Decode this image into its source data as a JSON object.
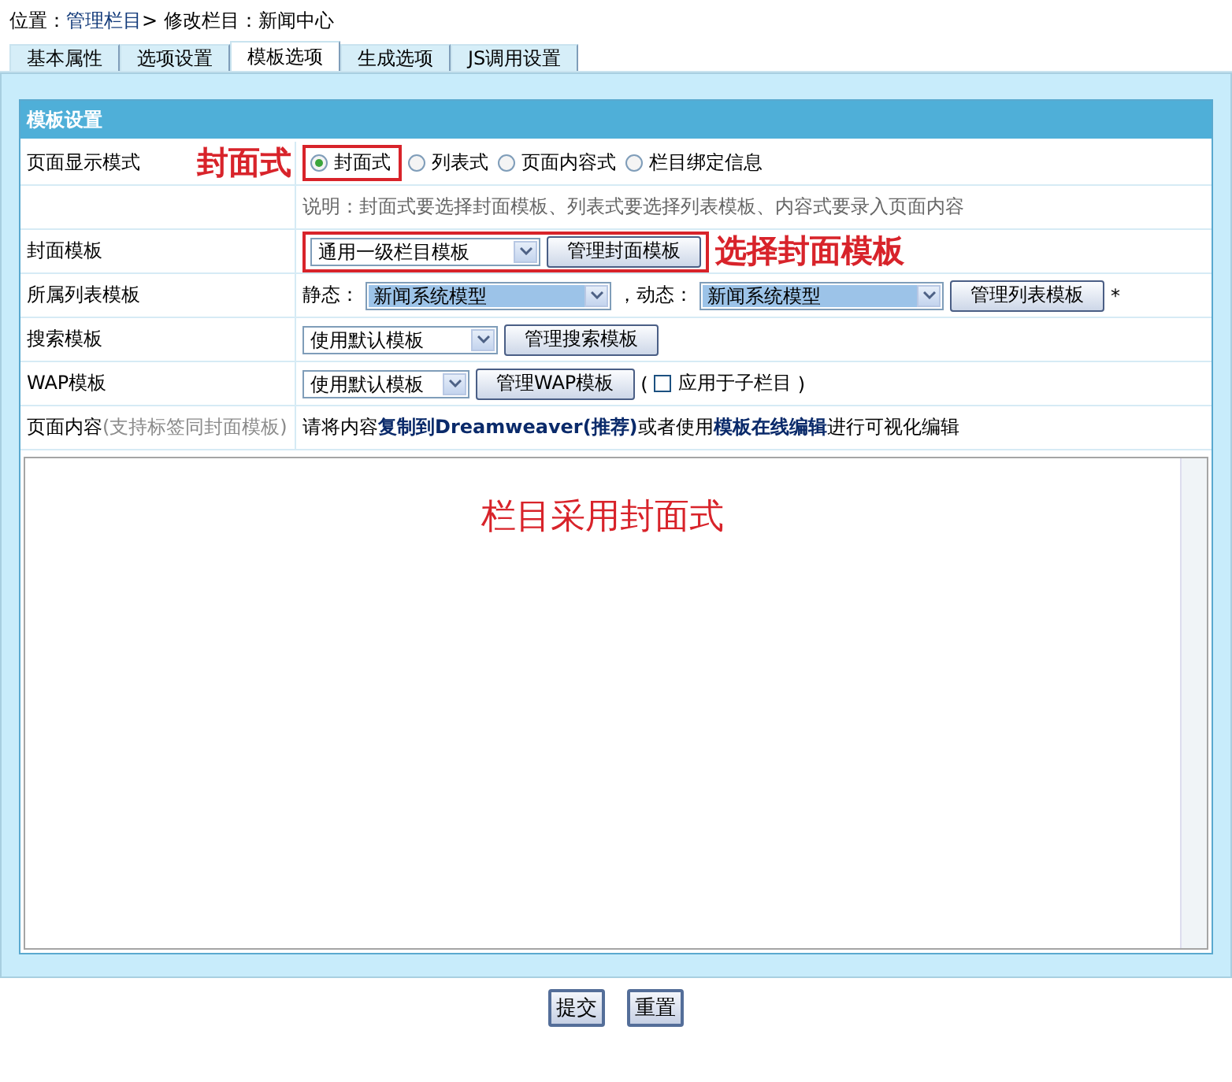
{
  "breadcrumb": [
    {
      "kind": "text",
      "text": "位置："
    },
    {
      "kind": "link",
      "text": "管理栏目"
    },
    {
      "kind": "text",
      "text": "> 修改栏目：新闻中心"
    }
  ],
  "tabs": [
    {
      "label": "基本属性",
      "selected": false
    },
    {
      "label": "选项设置",
      "selected": false
    },
    {
      "label": "模板选项",
      "selected": true
    },
    {
      "label": "生成选项",
      "selected": false
    },
    {
      "label": "JS调用设置",
      "selected": false
    }
  ],
  "section_title": "模板设置",
  "rows": [
    {
      "kind": "radios",
      "label": "页面显示模式",
      "annotation": "封面式",
      "options": [
        {
          "label": "封面式",
          "selected": true
        },
        {
          "label": "列表式",
          "selected": false
        },
        {
          "label": "页面内容式",
          "selected": false
        },
        {
          "label": "栏目绑定信息",
          "selected": false
        }
      ]
    },
    {
      "kind": "note",
      "text": "说明：封面式要选择封面模板、列表式要选择列表模板、内容式要录入页面内容"
    },
    {
      "kind": "select",
      "label": "封面模板",
      "select": "通用一级栏目模板",
      "button": "管理封面模板",
      "annotation": "选择封面模板"
    },
    {
      "kind": "list",
      "label": "所属列表模板",
      "static_label": "静态：",
      "static_select": "新闻系统模型",
      "dynamic_label": "，动态：",
      "dynamic_select": "新闻系统模型",
      "button": "管理列表模板",
      "required": "*"
    },
    {
      "kind": "select",
      "label": "搜索模板",
      "select": "使用默认模板",
      "button": "管理搜索模板"
    },
    {
      "kind": "select_check",
      "label": "WAP模板",
      "select": "使用默认模板",
      "button": "管理WAP模板",
      "open": "(",
      "check": {
        "label": "应用于子栏目",
        "checked": false
      },
      "close": ")"
    },
    {
      "kind": "content",
      "label": "页面内容",
      "hint": "(支持标签同封面模板)",
      "text": "请将内容**复制到Dreamweaver(推荐)**或者使用**模板在线编辑**进行可视化编辑"
    }
  ],
  "editor": {
    "annotation": "栏目采用封面式"
  },
  "buttons": [
    "提交",
    "重置"
  ]
}
